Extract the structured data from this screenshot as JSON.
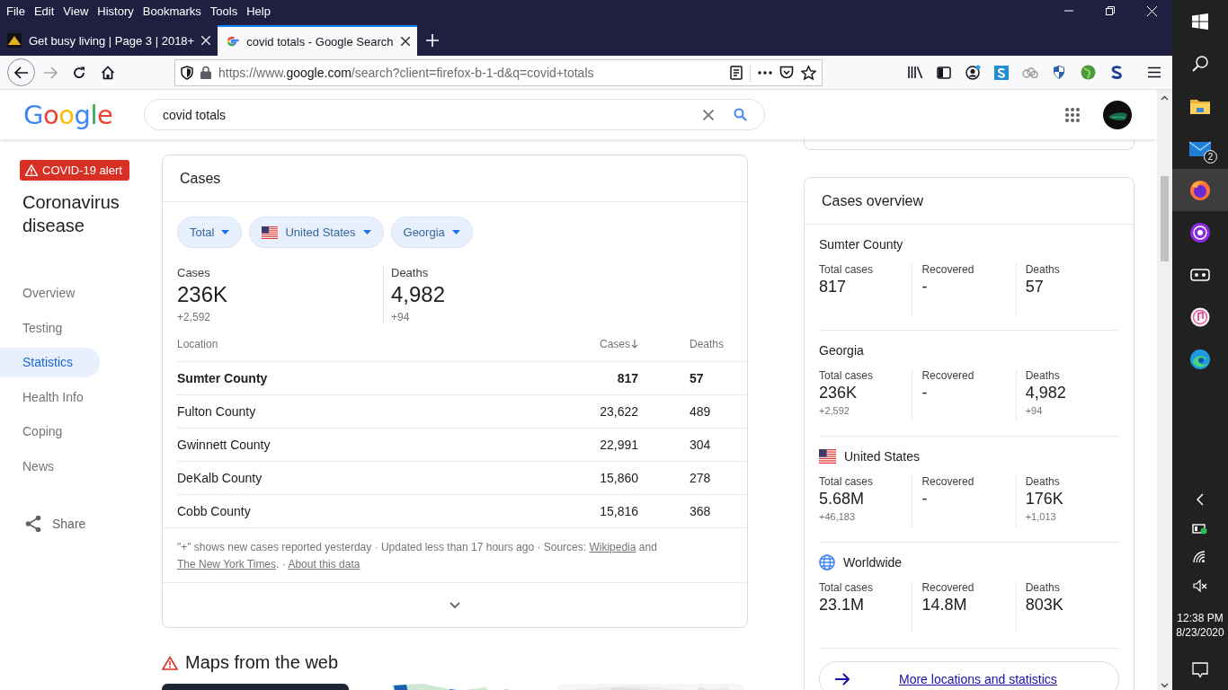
{
  "menu_bar": [
    "File",
    "Edit",
    "View",
    "History",
    "Bookmarks",
    "Tools",
    "Help"
  ],
  "tabs": [
    {
      "title": "Get busy living | Page 3 | 2018+",
      "selected": false
    },
    {
      "title": "covid totals - Google Search",
      "selected": true
    }
  ],
  "address_bar": {
    "url": "https://www.**google.com**/search?client=firefox-b-1-d&q=covid+totals"
  },
  "google_header": {
    "logo": "Google",
    "search_value": "covid totals"
  },
  "sidebar": {
    "alert": "COVID-19 alert",
    "title": "Coronavirus disease",
    "items": [
      {
        "label": "Overview",
        "selected": false
      },
      {
        "label": "Testing",
        "selected": false
      },
      {
        "label": "Statistics",
        "selected": true
      },
      {
        "label": "Health Info",
        "selected": false
      },
      {
        "label": "Coping",
        "selected": false
      },
      {
        "label": "News",
        "selected": false
      }
    ],
    "share": "Share"
  },
  "cases_card": {
    "title": "Cases",
    "filters": [
      {
        "label": "Total",
        "kind": "plain"
      },
      {
        "label": "United States",
        "kind": "flag"
      },
      {
        "label": "Georgia",
        "kind": "plain"
      }
    ],
    "stats": [
      {
        "label": "Cases",
        "value": "236K",
        "change": "+2,592"
      },
      {
        "label": "Deaths",
        "value": "4,982",
        "change": "+94"
      }
    ],
    "table": {
      "columns": [
        {
          "label": "Location",
          "sorted": false
        },
        {
          "label": "Cases",
          "sorted": true
        },
        {
          "label": "Deaths",
          "sorted": false
        }
      ],
      "rows": [
        {
          "cells": [
            "Sumter County",
            "817",
            "57"
          ],
          "highlighted": true
        },
        {
          "cells": [
            "Fulton County",
            "23,622",
            "489"
          ],
          "highlighted": false
        },
        {
          "cells": [
            "Gwinnett County",
            "22,991",
            "304"
          ],
          "highlighted": false
        },
        {
          "cells": [
            "DeKalb County",
            "15,860",
            "278"
          ],
          "highlighted": false
        },
        {
          "cells": [
            "Cobb County",
            "15,816",
            "368"
          ],
          "highlighted": false
        }
      ]
    },
    "footnote": [
      {
        "kind": "text",
        "text": "\"+\" shows new cases reported yesterday · Updated less than 17 hours ago  ·  Sources: "
      },
      {
        "kind": "link",
        "text": "Wikipedia"
      },
      {
        "kind": "text",
        "text": " and "
      },
      {
        "kind": "link",
        "text": "The New York Times"
      },
      {
        "kind": "text",
        "text": ".  ·  "
      },
      {
        "kind": "link",
        "text": "About this data"
      }
    ]
  },
  "maps_section": {
    "title": "Maps from the web"
  },
  "overview_card": {
    "title": "Cases overview",
    "sections": [
      {
        "place": "Sumter County",
        "kind": "plain",
        "stats": [
          {
            "label": "Total cases",
            "value": "817"
          },
          {
            "label": "Recovered",
            "value": "-"
          },
          {
            "label": "Deaths",
            "value": "57"
          }
        ]
      },
      {
        "place": "Georgia",
        "kind": "plain",
        "stats": [
          {
            "label": "Total cases",
            "value": "236K",
            "change": "+2,592"
          },
          {
            "label": "Recovered",
            "value": "-"
          },
          {
            "label": "Deaths",
            "value": "4,982",
            "change": "+94"
          }
        ]
      },
      {
        "place": "United States",
        "kind": "flag",
        "stats": [
          {
            "label": "Total cases",
            "value": "5.68M",
            "change": "+46,183"
          },
          {
            "label": "Recovered",
            "value": "-"
          },
          {
            "label": "Deaths",
            "value": "176K",
            "change": "+1,013"
          }
        ]
      },
      {
        "place": "Worldwide",
        "kind": "globe",
        "stats": [
          {
            "label": "Total cases",
            "value": "23.1M"
          },
          {
            "label": "Recovered",
            "value": "14.8M"
          },
          {
            "label": "Deaths",
            "value": "803K"
          }
        ]
      }
    ],
    "more_link": "More locations and statistics"
  },
  "taskbar": {
    "mail_badge": "2",
    "time": "12:38 PM",
    "date": "8/23/2020"
  }
}
